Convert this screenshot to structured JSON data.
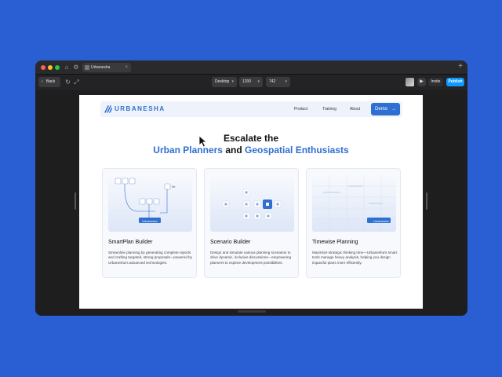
{
  "browser": {
    "tab_title": "Urbanesha",
    "tab_close": "×",
    "new_tab": "+"
  },
  "toolbar": {
    "back_label": "Back",
    "device": "Desktop",
    "width": "1200",
    "height": "742",
    "invite_label": "Invite",
    "publish_label": "Publish"
  },
  "site": {
    "logo": "URBANESHA",
    "nav": [
      "Product",
      "Training",
      "About"
    ],
    "demo_label": "Demo",
    "hero_line1": "Escalate the",
    "hero_blue1": "Urban Planners",
    "hero_and": " and ",
    "hero_blue2": "Geospatial Enthusiasts",
    "cards": [
      {
        "title": "SmartPlan Builder",
        "desc": "Streamline planning by generating complete reports and crafting targeted, strong proposals—powered by Urbanesha's advanced technologies.",
        "chip": "Urbanesha"
      },
      {
        "title": "Scenario Builder",
        "desc": "Design and simulate various planning scenarios to drive dynamic, inclusive discussions—empowering planners to explore development possibilities."
      },
      {
        "title": "Timewise Planning",
        "desc": "Maximize strategic thinking time—Urbanesha's smart tools manage heavy analysis, helping you design impactful plans more efficiently.",
        "chip": "Urbanesha"
      }
    ]
  },
  "colors": {
    "accent": "#2f6fd1",
    "publish": "#0d99ff",
    "background": "#2a5fd4"
  }
}
